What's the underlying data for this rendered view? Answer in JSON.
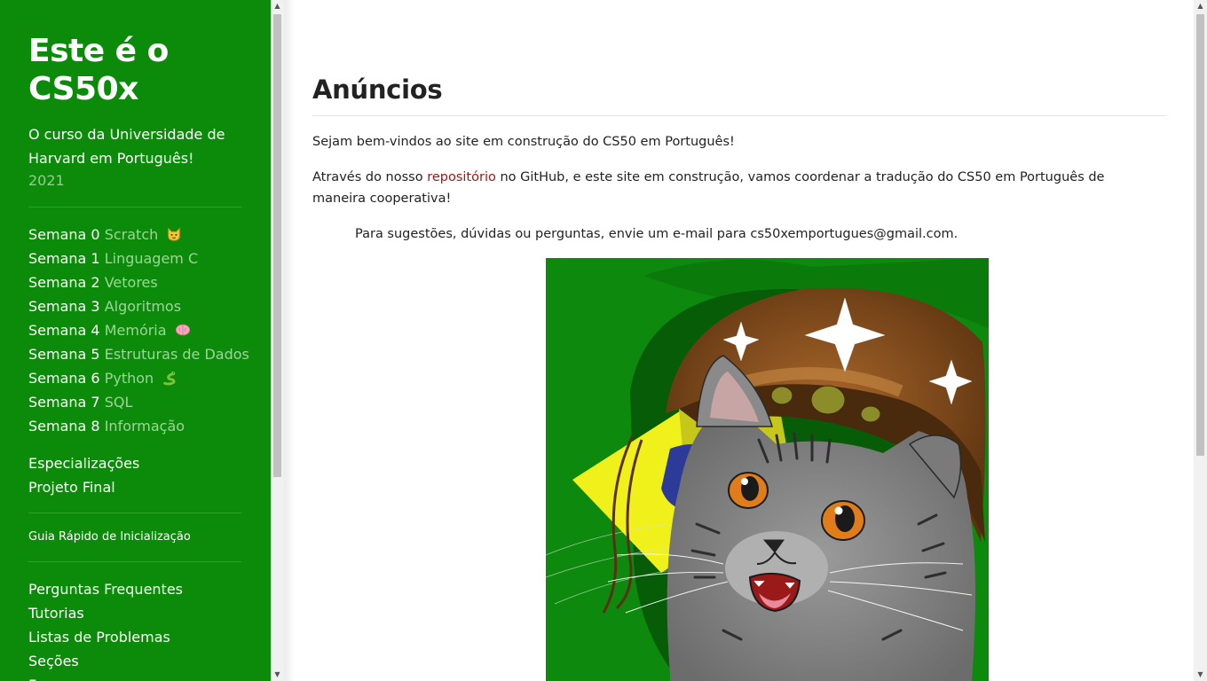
{
  "sidebar": {
    "title_line1": "Este é o",
    "title_line2": "CS50x",
    "description_line1": "O curso da Universidade de",
    "description_line2": "Harvard em Português!",
    "year": "2021",
    "weeks": [
      {
        "number": "Semana 0",
        "topic": "Scratch",
        "emoji": "cat-face-icon"
      },
      {
        "number": "Semana 1",
        "topic": "Linguagem C"
      },
      {
        "number": "Semana 2",
        "topic": "Vetores"
      },
      {
        "number": "Semana 3",
        "topic": "Algoritmos"
      },
      {
        "number": "Semana 4",
        "topic": "Memória",
        "emoji": "brain-icon"
      },
      {
        "number": "Semana 5",
        "topic": "Estruturas de Dados"
      },
      {
        "number": "Semana 6",
        "topic": "Python",
        "emoji": "snake-icon"
      },
      {
        "number": "Semana 7",
        "topic": "SQL"
      },
      {
        "number": "Semana 8",
        "topic": "Informação"
      }
    ],
    "specializations": "Especializações",
    "final_project": "Projeto Final",
    "quick_start": "Guia Rápido de Inicialização",
    "more_links": [
      "Perguntas Frequentes",
      "Tutorias",
      "Listas de Problemas",
      "Seções",
      "Fer"
    ]
  },
  "main": {
    "title": "Anúncios",
    "welcome": "Sejam bem-vindos ao site em construção do CS50 em Português!",
    "intro_before_link": "Através do nosso ",
    "intro_link": "repositório",
    "intro_after_link": " no GitHub, e este site em construção, vamos coordenar a tradução do CS50 em Português de maneira cooperativa!",
    "contact": "Para sugestões, dúvidas ou perguntas, envie um e-mail para cs50xemportugues@gmail.com.",
    "image_description": "cat-wearing-cangaceiro-hat-illustration"
  },
  "colors": {
    "sidebar_bg": "#0c8a09",
    "topic_text": "#9cd698",
    "year_text": "#8fd18b",
    "link": "#a31515"
  }
}
